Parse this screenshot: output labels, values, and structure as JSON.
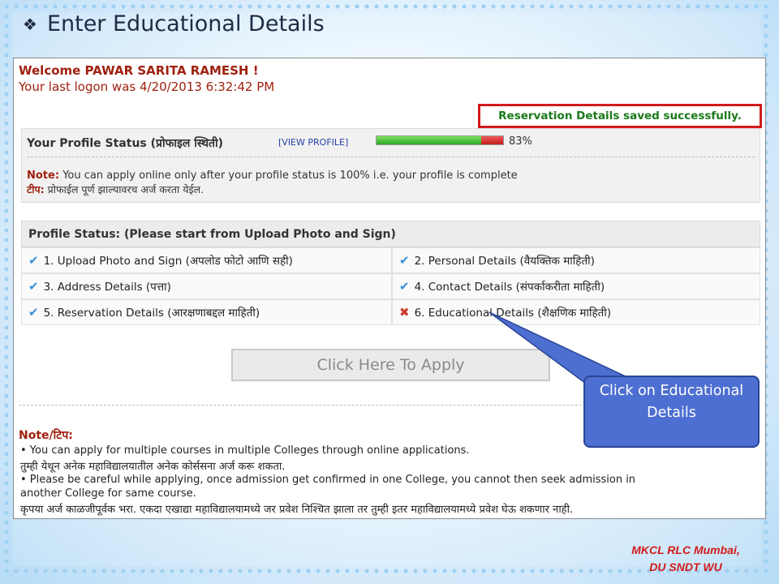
{
  "slide": {
    "title": "Enter Educational Details",
    "bullet_icon": "❖"
  },
  "portal": {
    "welcome": "Welcome PAWAR SARITA RAMESH !",
    "last_logon": "Your last logon was 4/20/2013 6:32:42 PM",
    "saved_message": "Reservation Details saved successfully.",
    "profile_status_label": "Your Profile Status (प्रोफाइल स्थिती)",
    "view_profile_link": "[VIEW PROFILE]",
    "progress_fraction": 0.83,
    "progress_text": "83%",
    "note_label": "Note:",
    "note_text": "You can apply online only after your profile status is 100% i.e. your profile is complete",
    "note_marathi_label": "टीप:",
    "note_marathi_text": "प्रोफाईल पूर्ण झाल्यावरच अर्ज करता येईल.",
    "status_header": "Profile Status: (Please start from Upload Photo and Sign)",
    "status_items": [
      {
        "label": "1. Upload Photo and Sign (अपलोड फोटो आणि सही)",
        "done": true
      },
      {
        "label": "2. Personal Details (वैयक्तिक माहिती)",
        "done": true
      },
      {
        "label": "3. Address Details (पत्ता)",
        "done": true
      },
      {
        "label": "4. Contact Details (संपर्काकरीता माहिती)",
        "done": true
      },
      {
        "label": "5. Reservation Details (आरक्षणाबद्दल माहिती)",
        "done": true
      },
      {
        "label": "6. Educational Details (शैक्षणिक माहिती)",
        "done": false
      }
    ],
    "apply_button": "Click Here To Apply",
    "note2_title": "Note/टिप:",
    "note2_lines": [
      "• You can apply for multiple courses in multiple Colleges through online applications.",
      "  तुम्ही येथून अनेक महाविद्यालयातील अनेक कोर्ससना अर्ज करू शकता.",
      "• Please be careful while applying, once admission get confirmed in one College, you cannot then seek admission in",
      "  another College for same course.",
      "  कृपया अर्ज काळजीपूर्वक भरा. एकदा एखाद्या महाविद्यालयामध्ये जर प्रवेश निश्चित झाला तर तुम्ही इतर महाविद्यालयामध्ये प्रवेश घेऊ शकणार नाही."
    ]
  },
  "callout": {
    "text": "Click on Educational Details"
  },
  "footer": {
    "line1": "MKCL RLC Mumbai,",
    "line2": "DU SNDT WU"
  },
  "colors": {
    "accent_red": "#a0200f",
    "success_green": "#1a7a1a",
    "callout_blue": "#4d6fd1",
    "check_blue": "#3a8fd6",
    "cross_red": "#d23a2b"
  }
}
